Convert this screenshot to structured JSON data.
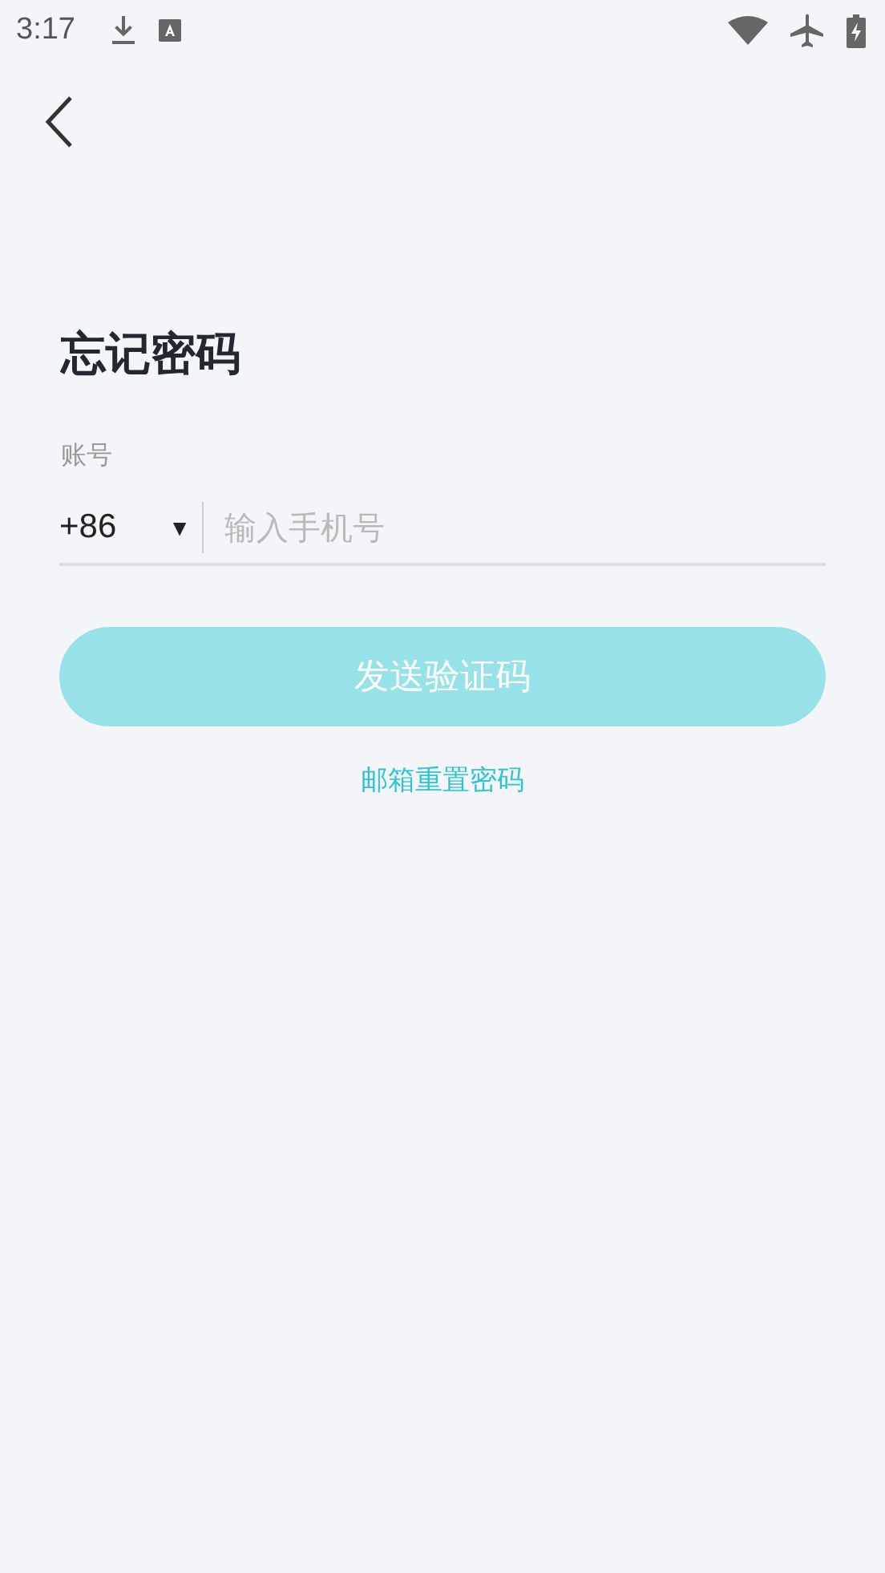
{
  "status_bar": {
    "time": "3:17"
  },
  "title": "忘记密码",
  "account_field": {
    "label": "账号",
    "country_code": "+86",
    "dropdown_glyph": "▼",
    "placeholder": "输入手机号"
  },
  "send_button": {
    "label": "发送验证码",
    "disabled": true
  },
  "email_reset_link": "邮箱重置密码"
}
